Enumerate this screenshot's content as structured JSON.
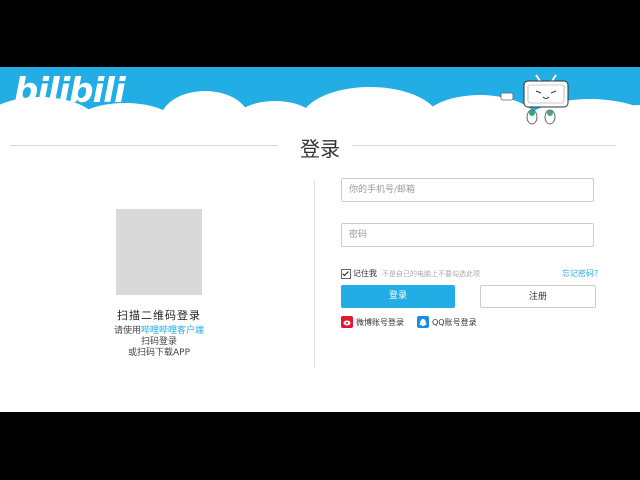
{
  "brand": {
    "logo_text": "bilibili"
  },
  "page_title": "登录",
  "qr": {
    "title": "扫描二维码登录",
    "line1_prefix": "请使用",
    "line1_link": "哔哩哔哩客户端",
    "line2": "扫码登录",
    "line3": "或扫码下载APP"
  },
  "form": {
    "username_placeholder": "你的手机号/邮箱",
    "password_placeholder": "密码",
    "remember_label": "记住我",
    "remember_checked": true,
    "remember_hint": "不是自己的电脑上不要勾选此项",
    "forgot_link": "忘记密码?",
    "login_button": "登录",
    "register_button": "注册"
  },
  "social": {
    "weibo_label": "微博账号登录",
    "qq_label": "QQ账号登录"
  },
  "colors": {
    "brand": "#23ade5",
    "background": "#ffffff",
    "letterbox": "#000000"
  }
}
